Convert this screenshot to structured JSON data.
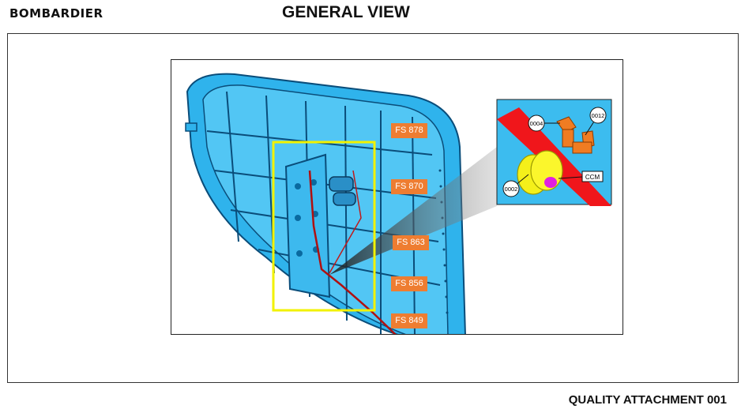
{
  "header": {
    "brand": "BOMBARDIER",
    "title": "GENERAL VIEW"
  },
  "footer": {
    "label": "QUALITY ATTACHMENT 001"
  },
  "figure": {
    "frame_labels": [
      "FS 878",
      "FS 870",
      "FS 863",
      "FS 856",
      "FS 849"
    ],
    "detail_callouts": {
      "c0004": "0004",
      "c0012": "0012",
      "c0002": "0002",
      "ccm": "CCM"
    }
  },
  "colors": {
    "fs_label": "#ee7d31",
    "highlight_box": "#f2f200",
    "structure": "#29a8e6",
    "wire": "#e01010"
  }
}
